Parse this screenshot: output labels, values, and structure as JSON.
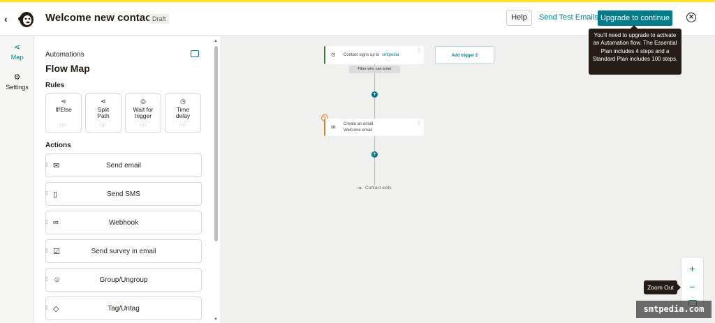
{
  "header": {
    "back_glyph": "‹",
    "title": "Welcome new contacts",
    "status_badge": "Draft",
    "help_label": "Help",
    "send_test_label": "Send Test Emails",
    "upgrade_label": "Upgrade to continue",
    "accent_color": "#007c89",
    "brand_strip_color": "#ffe01b"
  },
  "leftnav": {
    "items": [
      {
        "label": "Map",
        "icon": "flow-map-icon",
        "active": true
      },
      {
        "label": "Settings",
        "icon": "gear-icon",
        "active": false
      }
    ]
  },
  "panel": {
    "subtitle": "Automations",
    "title": "Flow Map",
    "rules_title": "Rules",
    "rules": [
      {
        "label_line1": "If/Else",
        "label_line2": "",
        "icon": "branch-icon"
      },
      {
        "label_line1": "Split",
        "label_line2": "Path",
        "icon": "split-icon"
      },
      {
        "label_line1": "Wait for",
        "label_line2": "trigger",
        "icon": "target-icon"
      },
      {
        "label_line1": "Time",
        "label_line2": "delay",
        "icon": "clock-icon"
      }
    ],
    "actions_title": "Actions",
    "actions": [
      {
        "label": "Send email",
        "icon": "envelope-icon"
      },
      {
        "label": "Send SMS",
        "icon": "phone-icon"
      },
      {
        "label": "Webhook",
        "icon": "webhook-icon"
      },
      {
        "label": "Send survey in email",
        "icon": "survey-icon"
      },
      {
        "label": "Group/Ungroup",
        "icon": "group-icon"
      },
      {
        "label": "Tag/Untag",
        "icon": "tag-icon"
      }
    ]
  },
  "canvas": {
    "trigger_card": {
      "text": "Contact signs up to",
      "link": "smtpedia"
    },
    "add_trigger_label": "Add trigger 2",
    "filter_label": "Filter who can enter",
    "email_card": {
      "line1": "Create an email",
      "line2": "Welcome email"
    },
    "exit_label": "Contact exits"
  },
  "tooltip": {
    "text": "You'll need to upgrade to activate an Automation flow. The Essential Plan includes 4 steps and a Standard Plan includes 100 steps."
  },
  "zoom": {
    "zoom_in_glyph": "+",
    "zoom_out_glyph": "−",
    "tooltip": "Zoom Out"
  },
  "watermark": "smtpedia.com"
}
